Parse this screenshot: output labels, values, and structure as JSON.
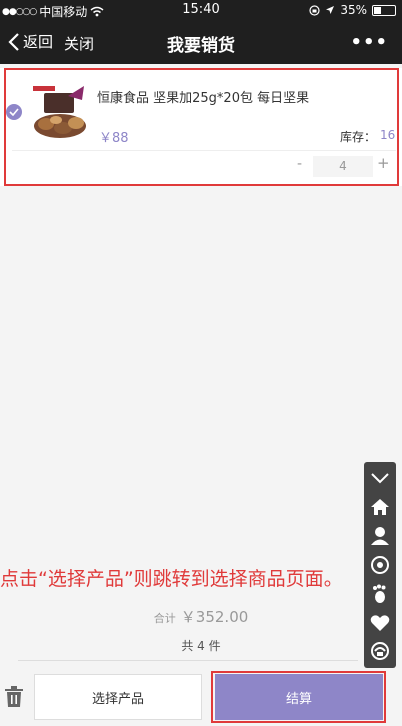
{
  "status_bar": {
    "carrier": "中国移动",
    "time": "15:40",
    "battery": "35%",
    "battery_level": 0.35
  },
  "nav": {
    "back_label": "返回",
    "close_label": "关闭",
    "title": "我要销货",
    "more_label": "•••"
  },
  "cart": {
    "item": {
      "name": "恒康食品 坚果加25g*20包 每日坚果",
      "price": "￥88",
      "stock_label": "库存：",
      "stock_value": "16",
      "quantity": "4",
      "minus_label": "-",
      "plus_label": "+",
      "selected": true
    }
  },
  "annotation": {
    "text": "点击“选择产品”则跳转到选择商品页面。"
  },
  "summary": {
    "total_label": "合计",
    "total_value": "￥352.00",
    "count_text": "共 4 件"
  },
  "actions": {
    "select_product_label": "选择产品",
    "checkout_label": "结算"
  },
  "colors": {
    "accent": "#8e86c8",
    "annotation_red": "#e03a3a",
    "nav_bg": "#1f1f1f"
  },
  "side_toolbar": {
    "icons": [
      "collapse-chevron-icon",
      "home-icon",
      "user-icon",
      "circle-icon",
      "footprint-icon",
      "heart-icon",
      "support-icon"
    ]
  }
}
